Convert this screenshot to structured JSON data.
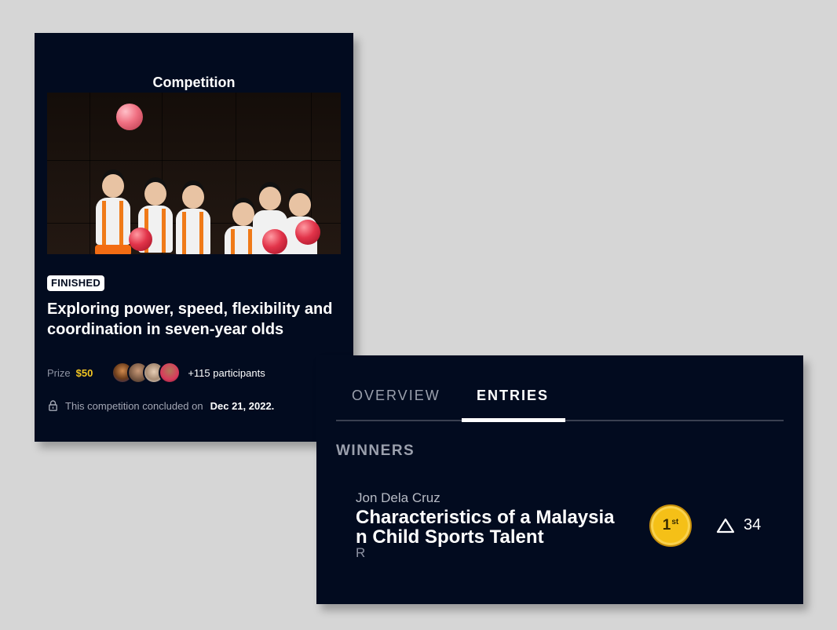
{
  "competition": {
    "header": "Competition",
    "status_badge": "FINISHED",
    "title": "Exploring power, speed, flexibility and coordination in seven-year olds",
    "prize_label": "Prize",
    "prize_value": "$50",
    "participants_text": "+115 participants",
    "concluded_text": "This competition concluded on",
    "concluded_date": "Dec 21, 2022."
  },
  "entries_panel": {
    "tabs": [
      {
        "label": "OVERVIEW",
        "active": false
      },
      {
        "label": "ENTRIES",
        "active": true
      }
    ],
    "section_title": "WINNERS",
    "winners": [
      {
        "author": "Jon Dela Cruz",
        "title": "Characteristics of a Malaysian Child Sports Talent",
        "title_tail": "R",
        "place": "1",
        "place_suffix": "st",
        "votes": "34"
      }
    ]
  },
  "colors": {
    "background": "#d6d6d6",
    "card": "#020b1f",
    "prize": "#f3c622",
    "medal": "#f5c017",
    "muted": "#9ba0ad"
  },
  "icons": {
    "lock": "lock-icon",
    "upvote": "upvote-triangle-icon",
    "medal": "gold-medal-icon"
  }
}
